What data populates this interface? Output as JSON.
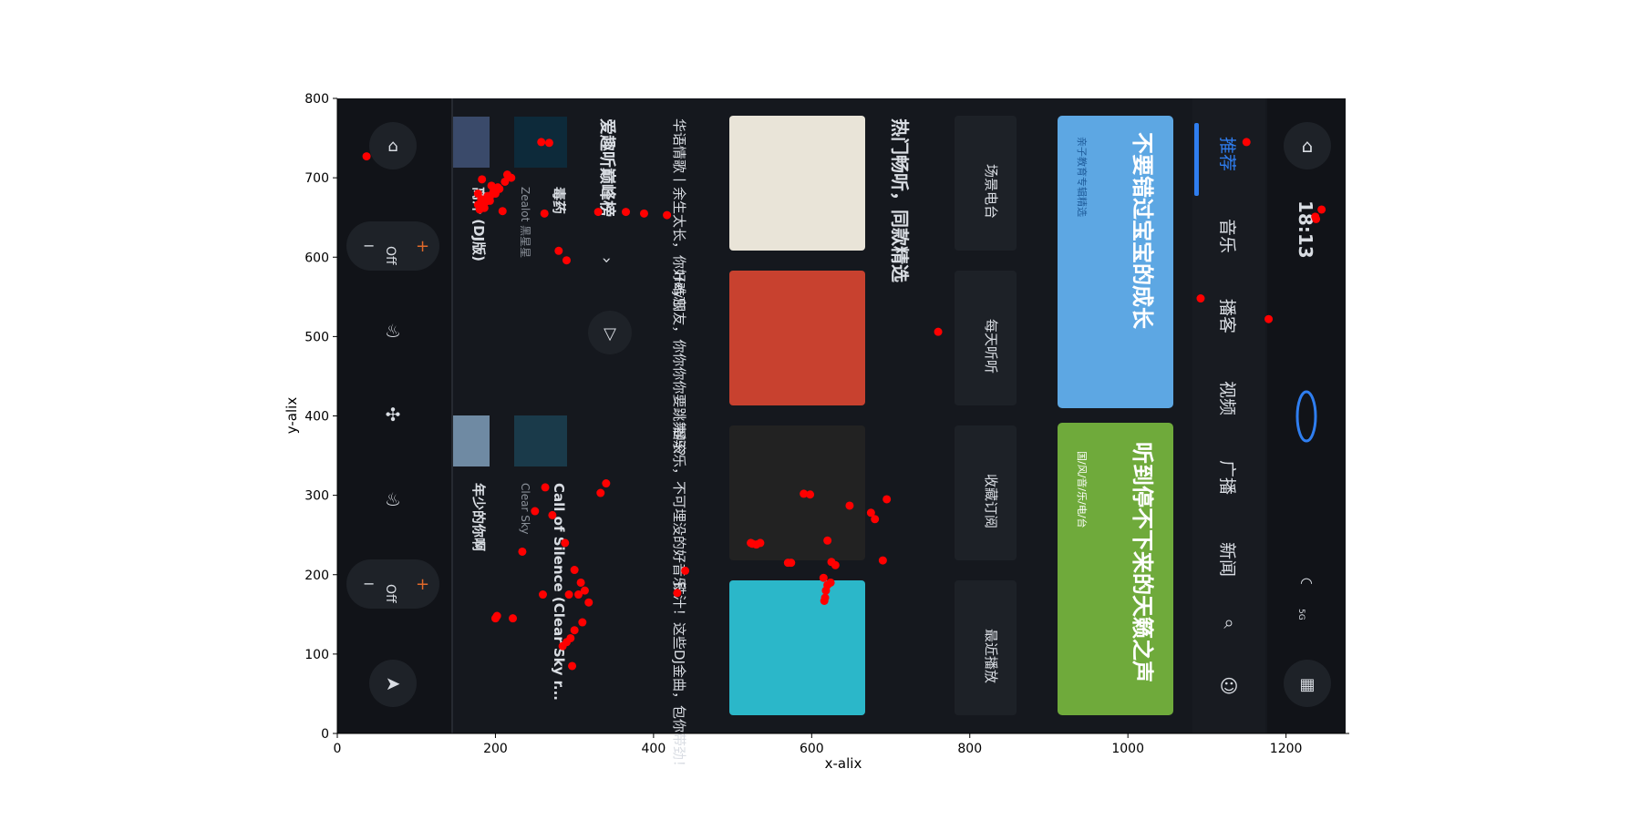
{
  "chart_data": {
    "type": "scatter",
    "title": "",
    "xlabel": "x-alix",
    "ylabel": "y-alix",
    "xlim": [
      0,
      1280
    ],
    "ylim": [
      0,
      800
    ],
    "xticks": [
      "0",
      "200",
      "400",
      "600",
      "800",
      "1000",
      "1200"
    ],
    "yticks": [
      "0",
      "100",
      "200",
      "300",
      "400",
      "500",
      "600",
      "700",
      "800"
    ],
    "grid": false,
    "legend": "none",
    "point_color": "#ff0000",
    "series": [
      {
        "x": [
          37,
          1150,
          1092,
          1178,
          1237,
          1245,
          1238,
          258,
          268,
          178,
          182,
          185,
          190,
          195,
          198,
          183,
          188,
          193,
          200,
          205,
          212,
          215,
          220,
          178,
          180,
          186,
          193,
          197,
          203,
          209,
          280,
          290,
          330,
          365,
          388,
          417,
          760,
          523,
          620,
          630,
          690,
          680,
          675,
          695,
          648,
          598,
          590,
          615,
          620,
          618,
          617,
          616,
          625,
          624,
          570,
          574,
          535,
          525,
          530,
          440,
          430,
          300,
          308,
          305,
          313,
          318,
          310,
          295,
          290,
          285,
          300,
          293,
          297,
          260,
          263,
          333,
          340,
          250,
          234,
          202,
          200,
          222,
          262,
          272,
          288
        ],
        "y": [
          727,
          745,
          548,
          522,
          651,
          660,
          648,
          745,
          744,
          680,
          673,
          668,
          677,
          690,
          684,
          698,
          670,
          676,
          680,
          686,
          695,
          704,
          700,
          666,
          660,
          662,
          671,
          681,
          688,
          658,
          608,
          596,
          657,
          657,
          655,
          653,
          506,
          240,
          243,
          212,
          218,
          270,
          278,
          295,
          287,
          301,
          302,
          196,
          187,
          180,
          171,
          167,
          216,
          190,
          215,
          215,
          240,
          239,
          238,
          205,
          177,
          206,
          190,
          175,
          180,
          165,
          140,
          120,
          115,
          110,
          130,
          175,
          85,
          175,
          310,
          303,
          315,
          280,
          229,
          148,
          145,
          145,
          655,
          275,
          240
        ]
      }
    ]
  },
  "embedded_ui": {
    "top_bar": {
      "clock": "18:13",
      "net_label": "5G"
    },
    "nav_tabs": [
      "推荐",
      "音乐",
      "播客",
      "视频",
      "广播",
      "新闻"
    ],
    "banners": [
      {
        "title": "不要错过宝宝的成长",
        "tag": "亲子教育专辑精选"
      },
      {
        "title": "听到停不下来的天籁之声",
        "tag": "国/风/音/乐/电/台"
      }
    ],
    "quick_entries": [
      "场景电台",
      "每天听听",
      "收藏订阅",
      "最近播放"
    ],
    "section_title": "热门畅听，同款精选",
    "cards": [
      {
        "caption": "华语情歌丨余生太长，你好难忘"
      },
      {
        "caption": "Hey朋友，你你你你要跳舞吗？"
      },
      {
        "caption": "摇滚乐，不可埋没的好音乐"
      },
      {
        "caption": "铁汁！这些DJ金曲，包你带劲！"
      }
    ],
    "chart_title": "爱趣听巅峰榜",
    "chart_arrow": "›",
    "tracks": [
      {
        "title": "毒药",
        "artist": "Zealot 黑星星"
      },
      {
        "title": "离汁 (DJ版)",
        "artist": ""
      },
      {
        "title": "Call of Silence (Clear Sky r...",
        "artist": "Clear Sky"
      },
      {
        "title": "年少的你啊",
        "artist": ""
      }
    ],
    "climate": {
      "left_value": "Off",
      "right_value": "Off",
      "minus": "−",
      "plus": "+"
    }
  }
}
